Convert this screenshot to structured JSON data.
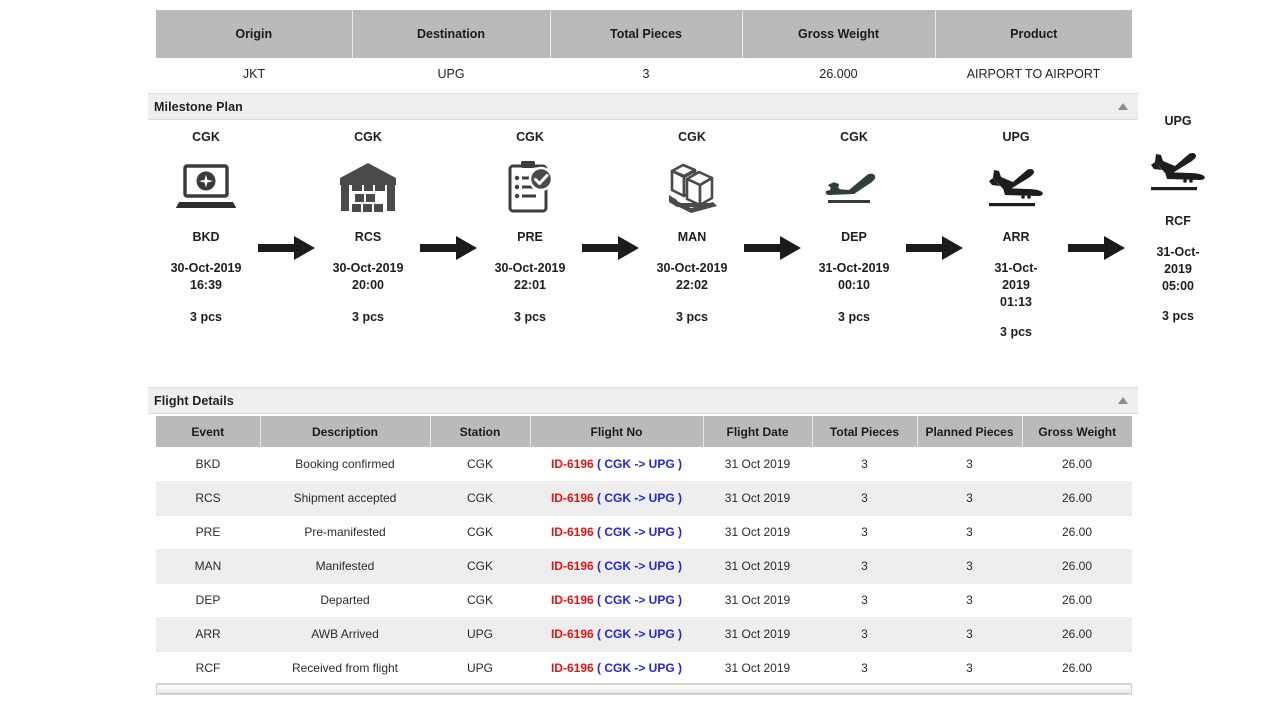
{
  "summary": {
    "columns": [
      "Origin",
      "Destination",
      "Total Pieces",
      "Gross Weight",
      "Product"
    ],
    "values": [
      "JKT",
      "UPG",
      "3",
      "26.000",
      "AIRPORT TO AIRPORT"
    ]
  },
  "milestone": {
    "section_title": "Milestone Plan",
    "collapse_icon": "caret-up-icon",
    "steps": [
      {
        "station": "CGK",
        "icon": "laptop-booking-icon",
        "code": "BKD",
        "time": "30-Oct-2019 16:39",
        "pieces": "3 pcs"
      },
      {
        "station": "CGK",
        "icon": "warehouse-icon",
        "code": "RCS",
        "time": "30-Oct-2019 20:00",
        "pieces": "3 pcs"
      },
      {
        "station": "CGK",
        "icon": "clipboard-check-icon",
        "code": "PRE",
        "time": "30-Oct-2019 22:01",
        "pieces": "3 pcs"
      },
      {
        "station": "CGK",
        "icon": "packages-pallet-icon",
        "code": "MAN",
        "time": "30-Oct-2019 22:02",
        "pieces": "3 pcs"
      },
      {
        "station": "CGK",
        "icon": "plane-departure-icon",
        "code": "DEP",
        "time": "31-Oct-2019 00:10",
        "pieces": "3 pcs"
      },
      {
        "station": "UPG",
        "icon": "plane-arrival-icon",
        "code": "ARR",
        "time": "31-Oct-2019 01:13",
        "pieces": "3 pcs"
      },
      {
        "station": "UPG",
        "icon": "plane-arrival-icon",
        "code": "RCF",
        "time": "31-Oct-2019 05:00",
        "pieces": "3 pcs"
      }
    ]
  },
  "flight_details": {
    "section_title": "Flight Details",
    "collapse_icon": "caret-up-icon",
    "columns": [
      "Event",
      "Description",
      "Station",
      "Flight No",
      "Flight Date",
      "Total Pieces",
      "Planned Pieces",
      "Gross Weight"
    ],
    "rows": [
      {
        "event": "BKD",
        "description": "Booking confirmed",
        "station": "CGK",
        "flight_id": "ID-6196",
        "flight_route": "( CGK -> UPG )",
        "flight_date": "31 Oct 2019",
        "total_pieces": "3",
        "planned_pieces": "3",
        "gross_weight": "26.00"
      },
      {
        "event": "RCS",
        "description": "Shipment accepted",
        "station": "CGK",
        "flight_id": "ID-6196",
        "flight_route": "( CGK -> UPG )",
        "flight_date": "31 Oct 2019",
        "total_pieces": "3",
        "planned_pieces": "3",
        "gross_weight": "26.00"
      },
      {
        "event": "PRE",
        "description": "Pre-manifested",
        "station": "CGK",
        "flight_id": "ID-6196",
        "flight_route": "( CGK -> UPG )",
        "flight_date": "31 Oct 2019",
        "total_pieces": "3",
        "planned_pieces": "3",
        "gross_weight": "26.00"
      },
      {
        "event": "MAN",
        "description": "Manifested",
        "station": "CGK",
        "flight_id": "ID-6196",
        "flight_route": "( CGK -> UPG )",
        "flight_date": "31 Oct 2019",
        "total_pieces": "3",
        "planned_pieces": "3",
        "gross_weight": "26.00"
      },
      {
        "event": "DEP",
        "description": "Departed",
        "station": "CGK",
        "flight_id": "ID-6196",
        "flight_route": "( CGK -> UPG )",
        "flight_date": "31 Oct 2019",
        "total_pieces": "3",
        "planned_pieces": "3",
        "gross_weight": "26.00"
      },
      {
        "event": "ARR",
        "description": "AWB Arrived",
        "station": "UPG",
        "flight_id": "ID-6196",
        "flight_route": "( CGK -> UPG )",
        "flight_date": "31 Oct 2019",
        "total_pieces": "3",
        "planned_pieces": "3",
        "gross_weight": "26.00"
      },
      {
        "event": "RCF",
        "description": "Received from flight",
        "station": "UPG",
        "flight_id": "ID-6196",
        "flight_route": "( CGK -> UPG )",
        "flight_date": "31 Oct 2019",
        "total_pieces": "3",
        "planned_pieces": "3",
        "gross_weight": "26.00"
      }
    ]
  },
  "colors": {
    "header_gray": "#bbbab8",
    "section_gray": "#efeff0",
    "row_alt": "#eeeeee",
    "flight_id_red": "#e51414",
    "flight_route_blue": "#2424dd",
    "icon_dark": "#333333",
    "icon_teal": "#2f3f3d"
  }
}
